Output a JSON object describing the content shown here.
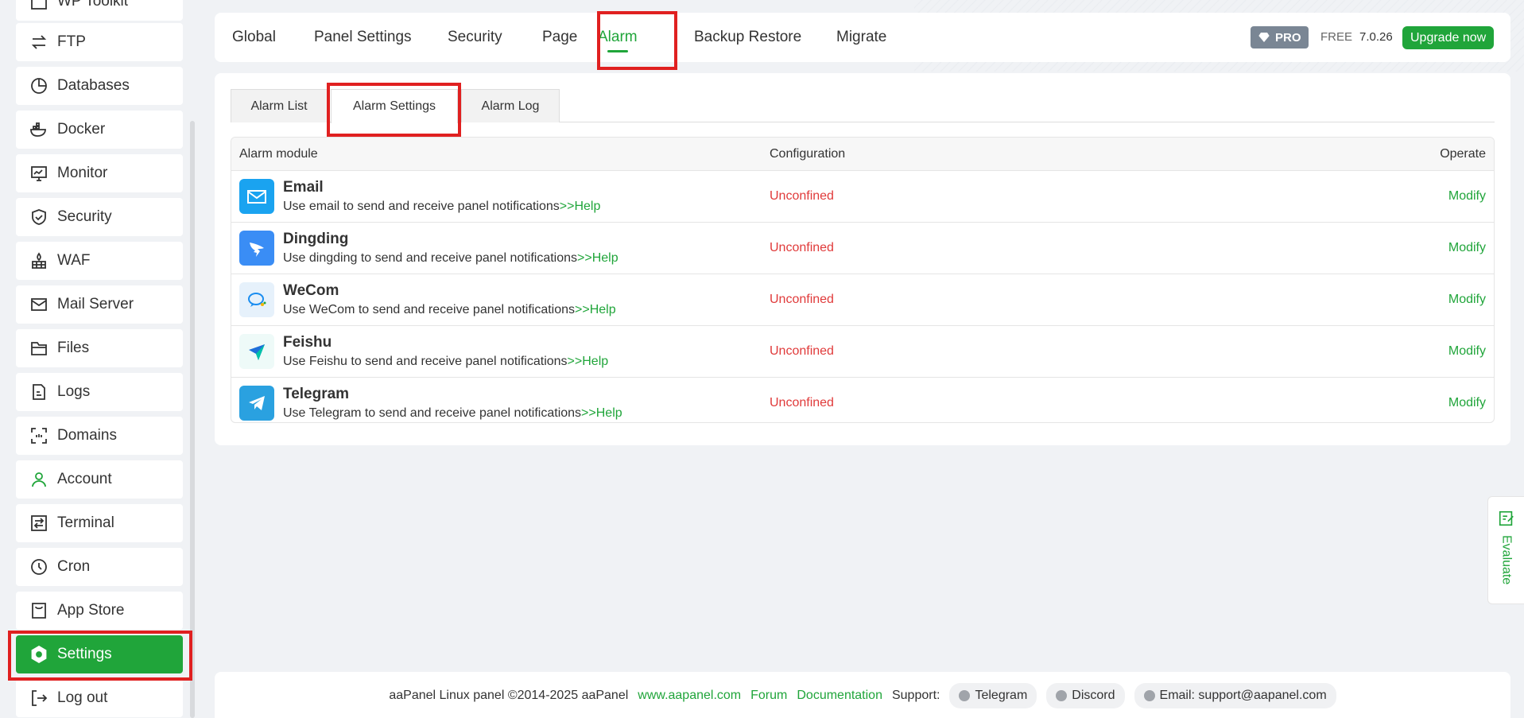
{
  "sidebar": {
    "items": [
      {
        "label": "WP Toolkit",
        "icon": "wp-icon"
      },
      {
        "label": "FTP",
        "icon": "transfer-icon"
      },
      {
        "label": "Databases",
        "icon": "database-icon"
      },
      {
        "label": "Docker",
        "icon": "docker-icon"
      },
      {
        "label": "Monitor",
        "icon": "monitor-icon"
      },
      {
        "label": "Security",
        "icon": "shield-icon"
      },
      {
        "label": "WAF",
        "icon": "firewall-icon"
      },
      {
        "label": "Mail Server",
        "icon": "mail-icon"
      },
      {
        "label": "Files",
        "icon": "folder-icon"
      },
      {
        "label": "Logs",
        "icon": "logs-icon"
      },
      {
        "label": "Domains",
        "icon": "domains-icon"
      },
      {
        "label": "Account",
        "icon": "user-icon"
      },
      {
        "label": "Terminal",
        "icon": "terminal-icon"
      },
      {
        "label": "Cron",
        "icon": "clock-icon"
      },
      {
        "label": "App Store",
        "icon": "store-icon"
      },
      {
        "label": "Settings",
        "icon": "settings-icon"
      },
      {
        "label": "Log out",
        "icon": "logout-icon"
      }
    ],
    "active": "Settings"
  },
  "topbar": {
    "tabs": [
      "Global",
      "Panel Settings",
      "Security",
      "Page",
      "Alarm",
      "Backup Restore",
      "Migrate"
    ],
    "active_tab": "Alarm",
    "pro_label": "PRO",
    "free_label": "FREE",
    "version": "7.0.26",
    "upgrade_label": "Upgrade now"
  },
  "subtabs": {
    "items": [
      "Alarm List",
      "Alarm Settings",
      "Alarm Log"
    ],
    "active": "Alarm Settings"
  },
  "table": {
    "headers": {
      "module": "Alarm module",
      "config": "Configuration",
      "operate": "Operate"
    },
    "rows": [
      {
        "name": "Email",
        "desc": "Use email to send and receive panel notifications",
        "help": ">>Help",
        "status": "Unconfined",
        "op": "Modify",
        "icon": "email-icon",
        "color": "#1aa3f0"
      },
      {
        "name": "Dingding",
        "desc": "Use dingding to send and receive panel notifications",
        "help": ">>Help",
        "status": "Unconfined",
        "op": "Modify",
        "icon": "dingding-icon",
        "color": "#3a8df5"
      },
      {
        "name": "WeCom",
        "desc": "Use WeCom to send and receive panel notifications",
        "help": ">>Help",
        "status": "Unconfined",
        "op": "Modify",
        "icon": "wecom-icon",
        "color": "#e6f1fb"
      },
      {
        "name": "Feishu",
        "desc": "Use Feishu to send and receive panel notifications",
        "help": ">>Help",
        "status": "Unconfined",
        "op": "Modify",
        "icon": "feishu-icon",
        "color": "#eefaf8"
      },
      {
        "name": "Telegram",
        "desc": "Use Telegram to send and receive panel notifications",
        "help": ">>Help",
        "status": "Unconfined",
        "op": "Modify",
        "icon": "telegram-icon",
        "color": "#2aa1e0"
      }
    ]
  },
  "footer": {
    "copyright": "aaPanel Linux panel ©2014-2025 aaPanel",
    "links": [
      "www.aapanel.com",
      "Forum",
      "Documentation"
    ],
    "support_label": "Support:",
    "pills": [
      "Telegram",
      "Discord",
      "Email: support@aapanel.com"
    ]
  },
  "evaluate": {
    "label": "Evaluate"
  },
  "colors": {
    "accent": "#20a53a",
    "danger": "#e03a3a",
    "highlight": "#e02020"
  }
}
